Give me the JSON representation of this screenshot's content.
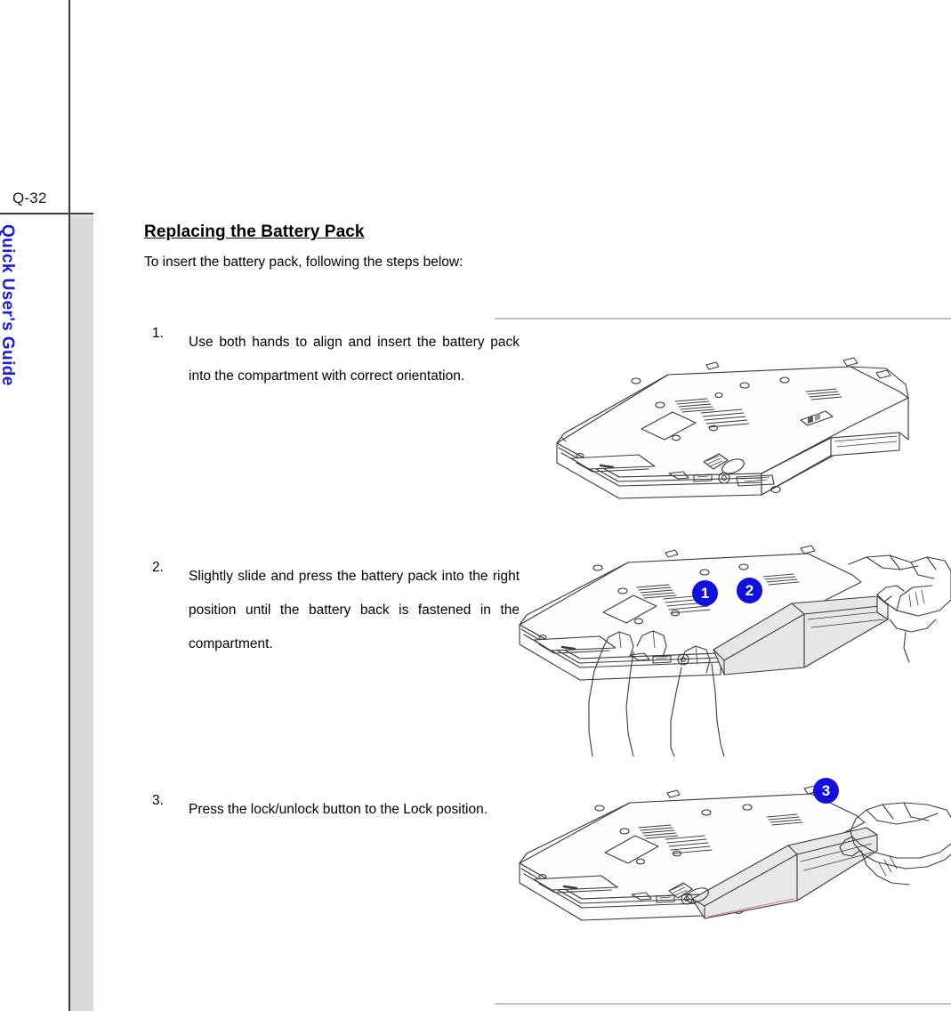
{
  "page": {
    "page_number": "Q-32",
    "sidebar_caption": "Quick User's Guide",
    "sidebar_color": "#1a1ae0",
    "rule_color": "#3b3b3b",
    "sidebar_strip_color": "#d9d9d9",
    "figure_rule_color": "#c2c2c2"
  },
  "section": {
    "heading": "Replacing the Battery Pack",
    "intro": "To insert the battery pack, following the steps below:"
  },
  "steps": [
    {
      "number": "1.",
      "text": "Use both hands to align and insert the battery pack into the compartment with correct orientation."
    },
    {
      "number": "2.",
      "text": "Slightly slide and press the battery pack into the right position until the battery back is fastened in the compartment."
    },
    {
      "number": "3.",
      "text": "Press the lock/unlock button to the Lock position."
    }
  ],
  "figures": [
    {
      "name": "notebook-bottom-with-battery-compartment",
      "caption": "",
      "badges": []
    },
    {
      "name": "hands-inserting-battery-pack",
      "caption": "",
      "badges": [
        {
          "label": "1",
          "color": "#1111dd"
        },
        {
          "label": "2",
          "color": "#1111dd"
        }
      ]
    },
    {
      "name": "hand-pressing-lock-button",
      "caption": "",
      "badges": [
        {
          "label": "3",
          "color": "#1111dd"
        }
      ]
    }
  ]
}
